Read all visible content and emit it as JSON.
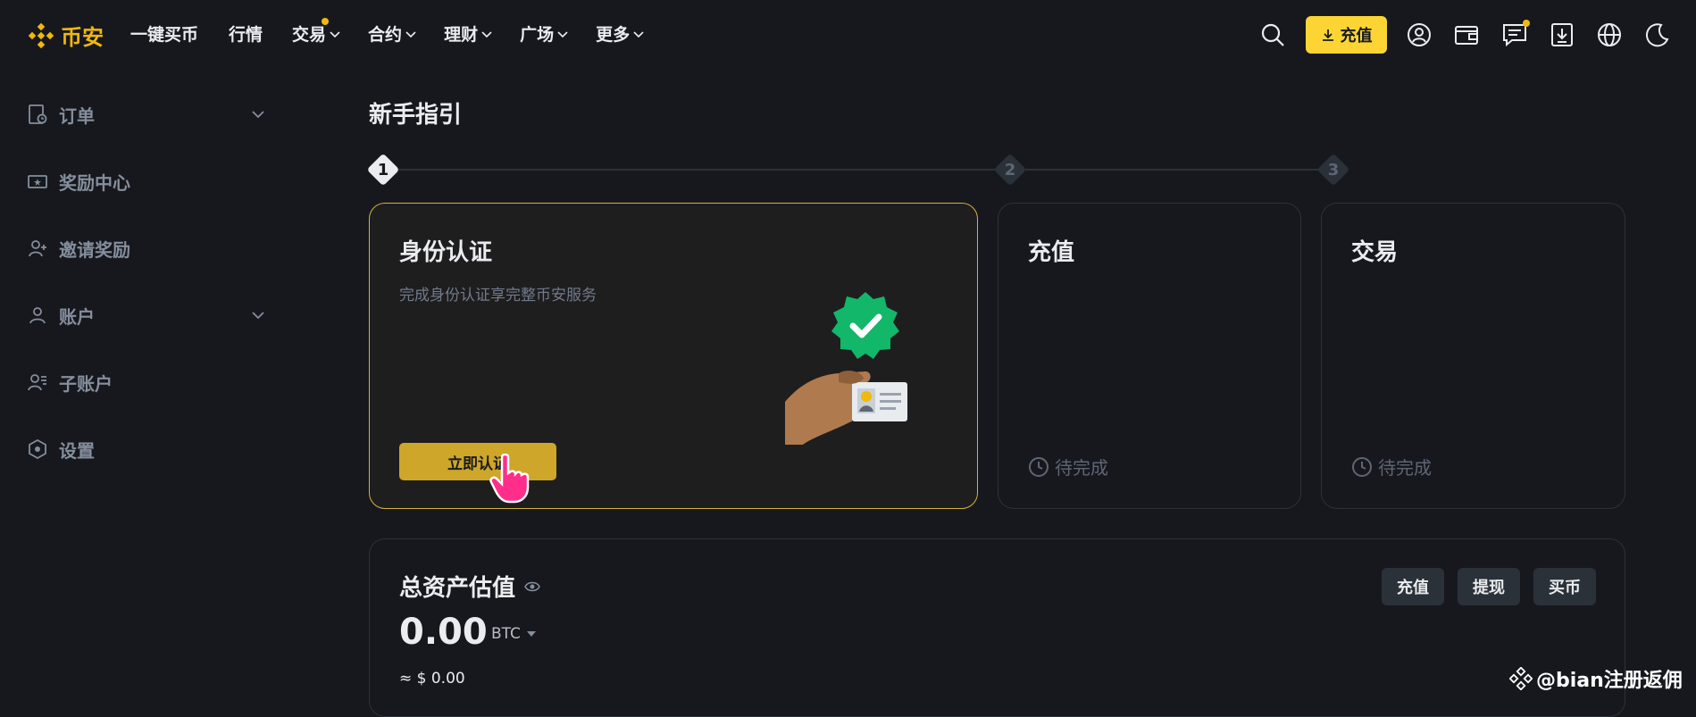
{
  "brand": {
    "name": "币安",
    "color": "#f0b90b"
  },
  "nav": [
    {
      "label": "一键买币",
      "has_menu": false,
      "dot": false
    },
    {
      "label": "行情",
      "has_menu": false,
      "dot": false
    },
    {
      "label": "交易",
      "has_menu": true,
      "dot": true
    },
    {
      "label": "合约",
      "has_menu": true,
      "dot": false
    },
    {
      "label": "理财",
      "has_menu": true,
      "dot": false
    },
    {
      "label": "广场",
      "has_menu": true,
      "dot": false
    },
    {
      "label": "更多",
      "has_menu": true,
      "dot": false
    }
  ],
  "topbar": {
    "deposit_label": "充值",
    "icons": [
      "search-icon",
      "user-icon",
      "wallet-icon",
      "message-icon",
      "download-icon",
      "globe-icon",
      "moon-icon"
    ]
  },
  "sidebar": {
    "items": [
      {
        "label": "订单",
        "icon": "order-icon",
        "expandable": true
      },
      {
        "label": "奖励中心",
        "icon": "reward-icon",
        "expandable": false
      },
      {
        "label": "邀请奖励",
        "icon": "invite-icon",
        "expandable": false
      },
      {
        "label": "账户",
        "icon": "account-icon",
        "expandable": true
      },
      {
        "label": "子账户",
        "icon": "sub-account-icon",
        "expandable": false
      },
      {
        "label": "设置",
        "icon": "settings-icon",
        "expandable": false
      }
    ]
  },
  "guide": {
    "title": "新手指引",
    "steps": [
      {
        "num": "1",
        "title": "身份认证",
        "desc": "完成身份认证享完整币安服务",
        "button": "立即认证",
        "active": true
      },
      {
        "num": "2",
        "title": "充值",
        "status": "待完成",
        "active": false
      },
      {
        "num": "3",
        "title": "交易",
        "status": "待完成",
        "active": false
      }
    ]
  },
  "assets": {
    "title": "总资产估值",
    "value": "0.00",
    "unit": "BTC",
    "usd": "≈ $ 0.00",
    "buttons": [
      "充值",
      "提现",
      "买币"
    ]
  },
  "watermark": "@bian注册返佣",
  "colors": {
    "accent": "#fcd535",
    "bg": "#17181e",
    "border": "#2b3139"
  }
}
